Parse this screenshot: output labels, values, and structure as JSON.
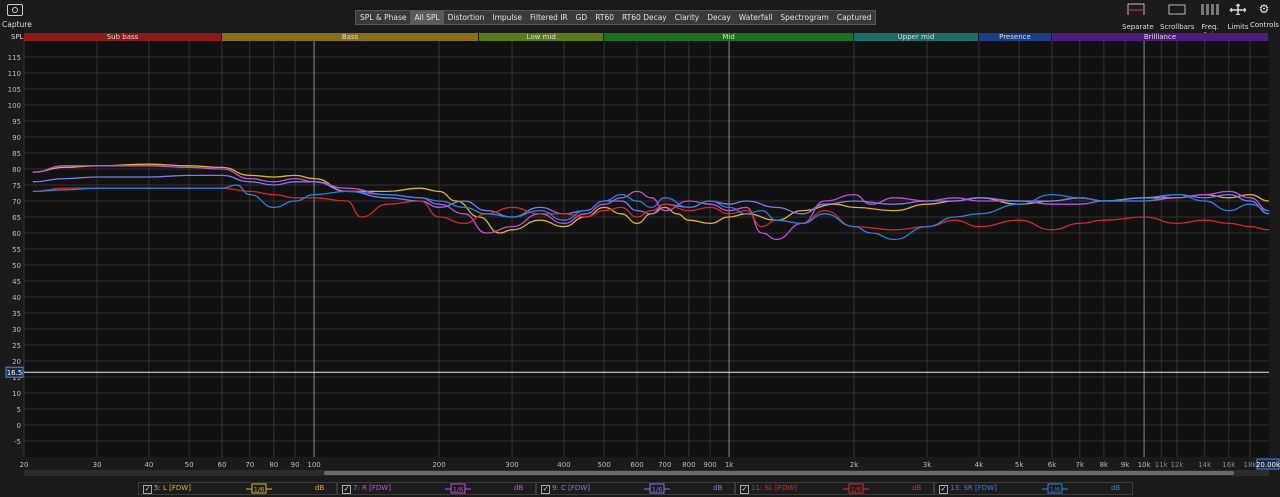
{
  "toolbar": {
    "capture_label": "Capture",
    "tabs": [
      "SPL & Phase",
      "All SPL",
      "Distortion",
      "Impulse",
      "Filtered IR",
      "GD",
      "RT60",
      "RT60 Decay",
      "Clarity",
      "Decay",
      "Waterfall",
      "Spectrogram",
      "Captured"
    ],
    "selected_tab": "All SPL",
    "right_tools": [
      "Separate",
      "Scrollbars",
      "Freq. Axis",
      "Limits",
      "Controls"
    ]
  },
  "bands": [
    {
      "name": "Sub bass",
      "from": 20,
      "to": 60,
      "color": "#8b1a1a"
    },
    {
      "name": "Bass",
      "from": 60,
      "to": 250,
      "color": "#8a6f1a"
    },
    {
      "name": "Low mid",
      "from": 250,
      "to": 500,
      "color": "#5b7a1c"
    },
    {
      "name": "Mid",
      "from": 500,
      "to": 2000,
      "color": "#1f6e23"
    },
    {
      "name": "Upper mid",
      "from": 2000,
      "to": 4000,
      "color": "#1a6d68"
    },
    {
      "name": "Presence",
      "from": 4000,
      "to": 6000,
      "color": "#1a3f86"
    },
    {
      "name": "Brilliance",
      "from": 6000,
      "to": 20000,
      "color": "#4f1a7e"
    }
  ],
  "marker_value": "16.5",
  "freq_readout": "20.00k",
  "chart_data": {
    "type": "line",
    "ylabel": "SPL",
    "xscale": "log",
    "xlim": [
      20,
      20000
    ],
    "ylim": [
      -10,
      120
    ],
    "yticks": [
      -5,
      0,
      5,
      10,
      15,
      20,
      25,
      30,
      35,
      40,
      45,
      50,
      55,
      60,
      65,
      70,
      75,
      80,
      85,
      90,
      95,
      100,
      105,
      110,
      115
    ],
    "xticks": [
      {
        "v": 20,
        "t": "20"
      },
      {
        "v": 30,
        "t": "30"
      },
      {
        "v": 40,
        "t": "40"
      },
      {
        "v": 50,
        "t": "50"
      },
      {
        "v": 60,
        "t": "60"
      },
      {
        "v": 70,
        "t": "70"
      },
      {
        "v": 80,
        "t": "80"
      },
      {
        "v": 90,
        "t": "90"
      },
      {
        "v": 100,
        "t": "100"
      },
      {
        "v": 200,
        "t": "200"
      },
      {
        "v": 300,
        "t": "300"
      },
      {
        "v": 400,
        "t": "400"
      },
      {
        "v": 500,
        "t": "500"
      },
      {
        "v": 600,
        "t": "600"
      },
      {
        "v": 700,
        "t": "700"
      },
      {
        "v": 800,
        "t": "800"
      },
      {
        "v": 900,
        "t": "900"
      },
      {
        "v": 1000,
        "t": "1k"
      },
      {
        "v": 2000,
        "t": "2k"
      },
      {
        "v": 3000,
        "t": "3k"
      },
      {
        "v": 4000,
        "t": "4k"
      },
      {
        "v": 5000,
        "t": "5k"
      },
      {
        "v": 6000,
        "t": "6k"
      },
      {
        "v": 7000,
        "t": "7k"
      },
      {
        "v": 8000,
        "t": "8k"
      },
      {
        "v": 9000,
        "t": "9k"
      },
      {
        "v": 10000,
        "t": "10k"
      },
      {
        "v": 11000,
        "t": "11k"
      },
      {
        "v": 12000,
        "t": "12k"
      },
      {
        "v": 14000,
        "t": "14k"
      },
      {
        "v": 16000,
        "t": "16k"
      },
      {
        "v": 18000,
        "t": "18k"
      }
    ],
    "marker_y": 16.5,
    "series": [
      {
        "name": "5: L [FDW]",
        "color": "#d9b236",
        "points": [
          [
            21,
            79
          ],
          [
            25,
            80.5
          ],
          [
            30,
            81
          ],
          [
            40,
            81.5
          ],
          [
            50,
            81
          ],
          [
            60,
            80.5
          ],
          [
            70,
            78
          ],
          [
            80,
            77.5
          ],
          [
            90,
            78
          ],
          [
            100,
            77
          ],
          [
            120,
            73
          ],
          [
            150,
            73
          ],
          [
            180,
            74
          ],
          [
            200,
            73
          ],
          [
            220,
            70
          ],
          [
            250,
            65
          ],
          [
            280,
            60
          ],
          [
            300,
            61
          ],
          [
            350,
            64
          ],
          [
            400,
            62
          ],
          [
            450,
            65
          ],
          [
            500,
            68
          ],
          [
            550,
            66
          ],
          [
            600,
            63
          ],
          [
            650,
            66
          ],
          [
            700,
            68
          ],
          [
            750,
            66
          ],
          [
            800,
            64
          ],
          [
            900,
            63
          ],
          [
            1000,
            65
          ],
          [
            1100,
            66
          ],
          [
            1300,
            64
          ],
          [
            1500,
            67
          ],
          [
            1800,
            69
          ],
          [
            2000,
            68
          ],
          [
            2500,
            67
          ],
          [
            3000,
            69
          ],
          [
            3500,
            70
          ],
          [
            4000,
            71
          ],
          [
            5000,
            69
          ],
          [
            6000,
            70
          ],
          [
            7000,
            71
          ],
          [
            8000,
            70
          ],
          [
            10000,
            71
          ],
          [
            12000,
            71
          ],
          [
            14000,
            72
          ],
          [
            16000,
            71
          ],
          [
            18000,
            72
          ],
          [
            20000,
            70
          ]
        ]
      },
      {
        "name": "7: R [FDW]",
        "color": "#c050d6",
        "points": [
          [
            21,
            79
          ],
          [
            25,
            81
          ],
          [
            30,
            81
          ],
          [
            40,
            81
          ],
          [
            50,
            80.5
          ],
          [
            60,
            80
          ],
          [
            70,
            77
          ],
          [
            80,
            76
          ],
          [
            90,
            77
          ],
          [
            100,
            76
          ],
          [
            120,
            74
          ],
          [
            150,
            72
          ],
          [
            180,
            71
          ],
          [
            200,
            69
          ],
          [
            230,
            66
          ],
          [
            260,
            60
          ],
          [
            300,
            62
          ],
          [
            350,
            66
          ],
          [
            400,
            63
          ],
          [
            450,
            66
          ],
          [
            500,
            69
          ],
          [
            550,
            71
          ],
          [
            600,
            73
          ],
          [
            650,
            71
          ],
          [
            700,
            67
          ],
          [
            800,
            70
          ],
          [
            900,
            69
          ],
          [
            1000,
            67
          ],
          [
            1100,
            68
          ],
          [
            1200,
            60
          ],
          [
            1300,
            58
          ],
          [
            1500,
            63
          ],
          [
            1700,
            70
          ],
          [
            2000,
            72
          ],
          [
            2200,
            69
          ],
          [
            2500,
            71
          ],
          [
            3000,
            70
          ],
          [
            3500,
            71
          ],
          [
            4000,
            70
          ],
          [
            5000,
            70
          ],
          [
            6000,
            69
          ],
          [
            7000,
            69
          ],
          [
            8000,
            70
          ],
          [
            10000,
            70
          ],
          [
            12000,
            71
          ],
          [
            14000,
            72
          ],
          [
            16000,
            73
          ],
          [
            18000,
            71
          ],
          [
            20000,
            67
          ]
        ]
      },
      {
        "name": "9: C [FDW]",
        "color": "#7b7bf0",
        "points": [
          [
            21,
            76
          ],
          [
            25,
            77
          ],
          [
            30,
            77.5
          ],
          [
            40,
            77.5
          ],
          [
            50,
            78
          ],
          [
            60,
            78
          ],
          [
            70,
            76
          ],
          [
            80,
            75
          ],
          [
            90,
            76
          ],
          [
            100,
            76
          ],
          [
            120,
            73
          ],
          [
            150,
            71
          ],
          [
            180,
            70
          ],
          [
            200,
            68
          ],
          [
            230,
            70
          ],
          [
            260,
            67
          ],
          [
            300,
            65
          ],
          [
            350,
            68
          ],
          [
            400,
            66
          ],
          [
            450,
            67
          ],
          [
            500,
            70
          ],
          [
            550,
            70
          ],
          [
            600,
            67
          ],
          [
            650,
            66
          ],
          [
            700,
            69
          ],
          [
            800,
            68
          ],
          [
            900,
            70
          ],
          [
            1000,
            69
          ],
          [
            1100,
            70
          ],
          [
            1300,
            68
          ],
          [
            1500,
            66
          ],
          [
            1700,
            69
          ],
          [
            2000,
            70
          ],
          [
            2500,
            69
          ],
          [
            3000,
            70
          ],
          [
            3500,
            70
          ],
          [
            4000,
            71
          ],
          [
            5000,
            70
          ],
          [
            6000,
            70
          ],
          [
            7000,
            71
          ],
          [
            8000,
            70
          ],
          [
            10000,
            71
          ],
          [
            12000,
            72
          ],
          [
            14000,
            71
          ],
          [
            16000,
            72
          ],
          [
            18000,
            70
          ],
          [
            20000,
            66
          ]
        ]
      },
      {
        "name": "11: SL [FDW]",
        "color": "#d02a2a",
        "points": [
          [
            21,
            73
          ],
          [
            25,
            74
          ],
          [
            30,
            74
          ],
          [
            40,
            74
          ],
          [
            50,
            74
          ],
          [
            60,
            74
          ],
          [
            70,
            73
          ],
          [
            80,
            72
          ],
          [
            90,
            71
          ],
          [
            100,
            71
          ],
          [
            120,
            70
          ],
          [
            130,
            65
          ],
          [
            150,
            69
          ],
          [
            180,
            70
          ],
          [
            200,
            65
          ],
          [
            230,
            63
          ],
          [
            260,
            66
          ],
          [
            300,
            68
          ],
          [
            350,
            66
          ],
          [
            400,
            66
          ],
          [
            450,
            65
          ],
          [
            500,
            67
          ],
          [
            550,
            68
          ],
          [
            600,
            65
          ],
          [
            650,
            67
          ],
          [
            700,
            69
          ],
          [
            800,
            67
          ],
          [
            900,
            68
          ],
          [
            1000,
            66
          ],
          [
            1100,
            67
          ],
          [
            1200,
            62
          ],
          [
            1300,
            64
          ],
          [
            1500,
            63
          ],
          [
            1700,
            67
          ],
          [
            2000,
            62
          ],
          [
            2500,
            61
          ],
          [
            3000,
            62
          ],
          [
            3500,
            64
          ],
          [
            4000,
            62
          ],
          [
            5000,
            64
          ],
          [
            6000,
            61
          ],
          [
            7000,
            63
          ],
          [
            8000,
            64
          ],
          [
            10000,
            65
          ],
          [
            12000,
            63
          ],
          [
            14000,
            64
          ],
          [
            16000,
            63
          ],
          [
            18000,
            62
          ],
          [
            20000,
            61
          ]
        ]
      },
      {
        "name": "13: SR [FDW]",
        "color": "#2e7fd8",
        "points": [
          [
            21,
            73
          ],
          [
            25,
            73.5
          ],
          [
            30,
            74
          ],
          [
            40,
            74
          ],
          [
            50,
            74
          ],
          [
            60,
            74
          ],
          [
            65,
            75
          ],
          [
            70,
            72
          ],
          [
            80,
            68
          ],
          [
            90,
            70
          ],
          [
            100,
            72
          ],
          [
            120,
            73
          ],
          [
            150,
            72
          ],
          [
            180,
            71
          ],
          [
            200,
            70
          ],
          [
            230,
            68
          ],
          [
            260,
            66
          ],
          [
            300,
            65
          ],
          [
            350,
            67
          ],
          [
            400,
            64
          ],
          [
            450,
            67
          ],
          [
            500,
            70
          ],
          [
            550,
            72
          ],
          [
            600,
            70
          ],
          [
            650,
            68
          ],
          [
            700,
            71
          ],
          [
            800,
            68
          ],
          [
            900,
            70
          ],
          [
            1000,
            68
          ],
          [
            1100,
            66
          ],
          [
            1200,
            67
          ],
          [
            1300,
            64
          ],
          [
            1500,
            63
          ],
          [
            1700,
            66
          ],
          [
            2000,
            62
          ],
          [
            2200,
            60
          ],
          [
            2500,
            58
          ],
          [
            3000,
            62
          ],
          [
            3500,
            65
          ],
          [
            4000,
            66
          ],
          [
            5000,
            69
          ],
          [
            6000,
            72
          ],
          [
            7000,
            71
          ],
          [
            8000,
            70
          ],
          [
            10000,
            70
          ],
          [
            12000,
            72
          ],
          [
            14000,
            70
          ],
          [
            16000,
            67
          ],
          [
            18000,
            69
          ],
          [
            20000,
            67
          ]
        ]
      }
    ]
  },
  "legend": [
    {
      "label": "5: L [FDW]",
      "smooth": "1/6",
      "unit": "dB",
      "color": "#d9b236"
    },
    {
      "label": "7: R [FDW]",
      "smooth": "1/6",
      "unit": "dB",
      "color": "#c050d6"
    },
    {
      "label": "9: C [FDW]",
      "smooth": "1/6",
      "unit": "dB",
      "color": "#7b7bf0"
    },
    {
      "label": "11: SL [FDW]",
      "smooth": "1/6",
      "unit": "dB",
      "color": "#d02a2a"
    },
    {
      "label": "13: SR [FDW]",
      "smooth": "1/6",
      "unit": "dB",
      "color": "#2e7fd8"
    }
  ]
}
